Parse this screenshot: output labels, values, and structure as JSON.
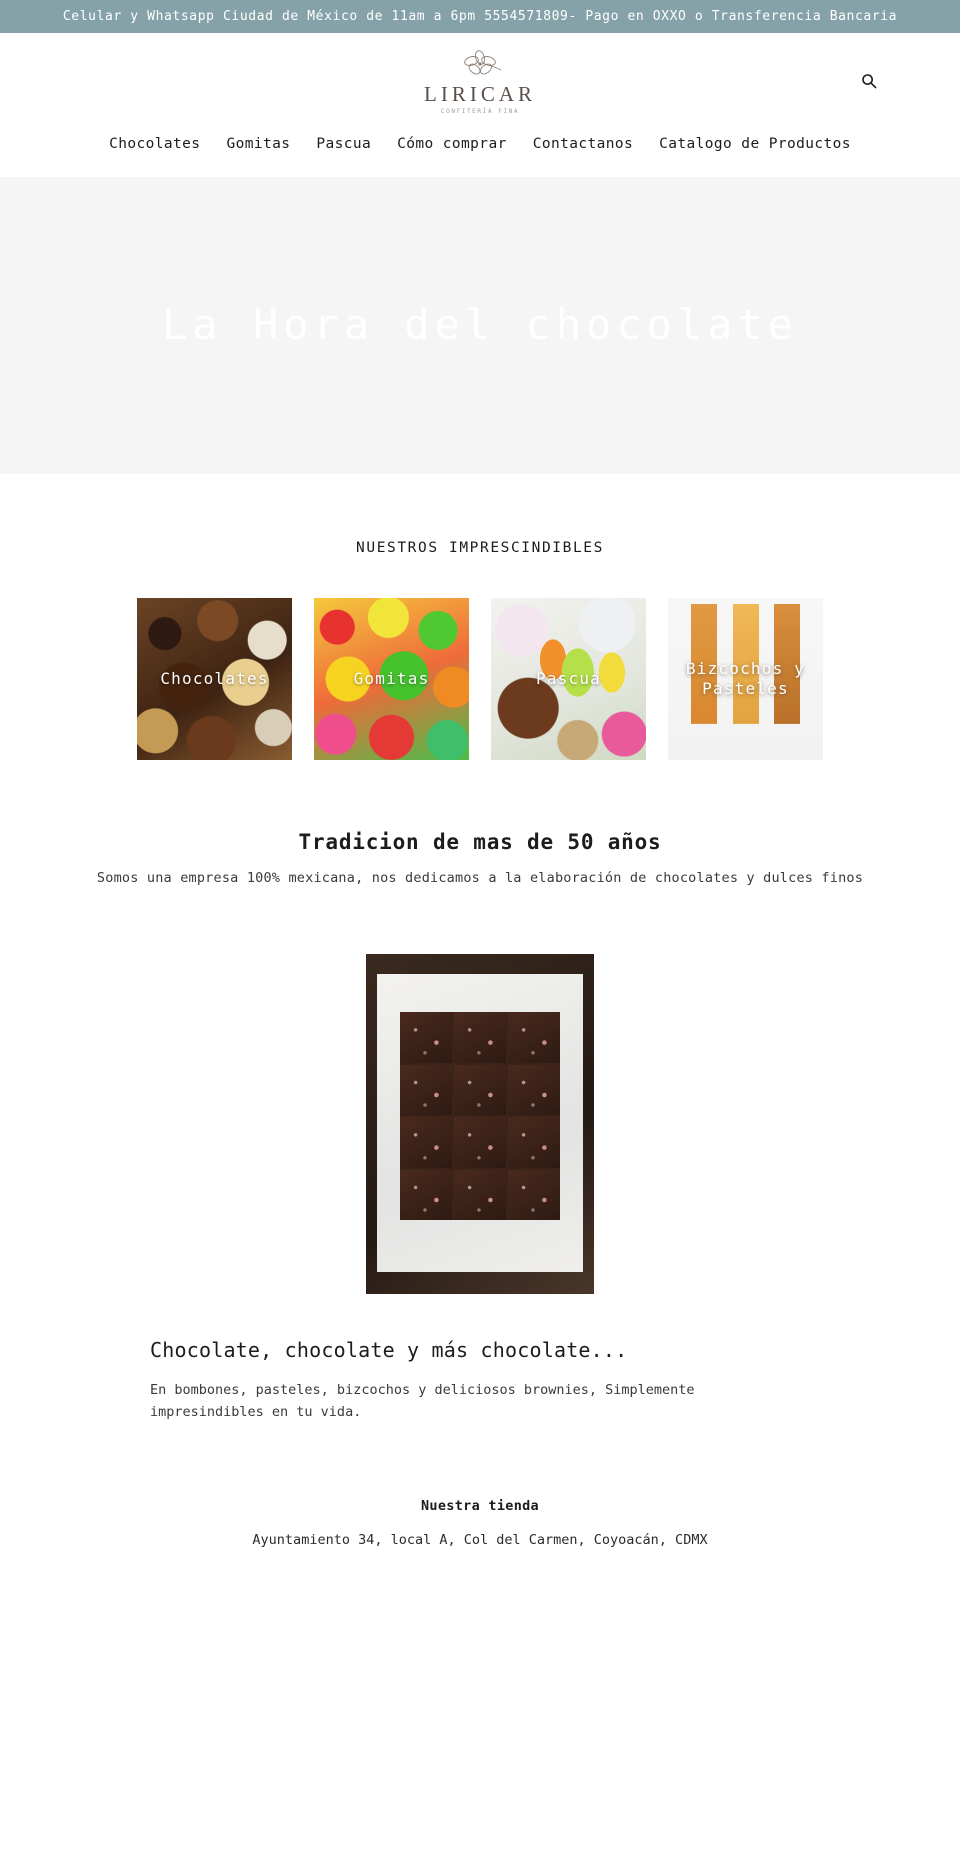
{
  "announcement": {
    "text": "Celular y Whatsapp Ciudad de México de 11am a 6pm 5554571809- Pago en OXXO o Transferencia Bancaria",
    "background_color": "#86a2a9",
    "text_color": "#ffffff"
  },
  "header": {
    "logo_wordmark": "LIRICAR",
    "logo_tagline": "CONFITERÍA FINA",
    "logo_icon": "flower-icon",
    "search_icon": "search-icon",
    "logo_color": "#5c5049"
  },
  "nav": {
    "items": [
      {
        "label": "Chocolates"
      },
      {
        "label": "Gomitas"
      },
      {
        "label": "Pascua"
      },
      {
        "label": "Cómo comprar"
      },
      {
        "label": "Contactanos"
      },
      {
        "label": "Catalogo de Productos"
      }
    ]
  },
  "hero": {
    "title": "La Hora del chocolate",
    "background_color": "#f5f5f5",
    "text_color": "#ffffff"
  },
  "featured": {
    "eyebrow": "NUESTROS IMPRESCINDIBLES",
    "cards": [
      {
        "label": "Chocolates",
        "art": "chocolates-photo"
      },
      {
        "label": "Gomitas",
        "art": "gomitas-photo"
      },
      {
        "label": "Pascua",
        "art": "pascua-photo"
      },
      {
        "label": "Bizcochos y Pasteles",
        "art": "bizcochos-photo"
      }
    ]
  },
  "tradition": {
    "title": "Tradicion de mas de 50 años",
    "subtitle": "Somos una empresa 100% mexicana, nos dedicamos a la elaboración de chocolates y dulces finos"
  },
  "feature": {
    "image_alt": "brownies-photo",
    "title": "Chocolate, chocolate y más chocolate...",
    "paragraph": "En bombones, pasteles, bizcochos y deliciosos brownies, Simplemente impresindibles en tu vida."
  },
  "footer": {
    "heading": "Nuestra tienda",
    "address": "Ayuntamiento 34, local A, Col del Carmen, Coyoacán, CDMX"
  }
}
